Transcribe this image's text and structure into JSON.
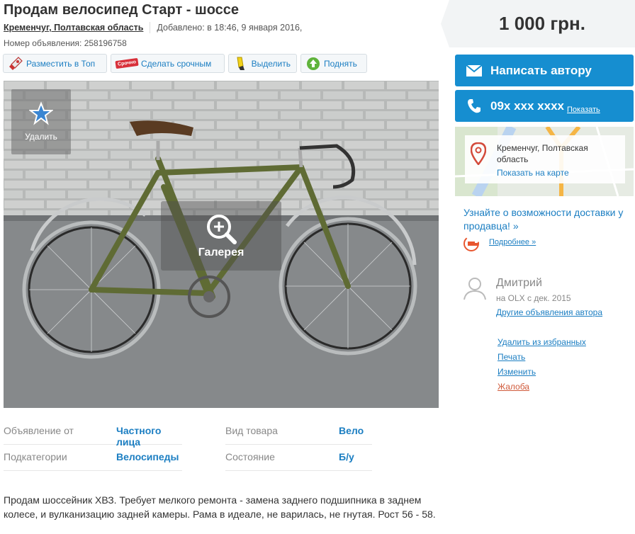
{
  "ad": {
    "title": "Продам велосипед Старт - шоссе",
    "location": "Кременчуг, Полтавская область",
    "added": "Добавлено: в 18:46, 9 января 2016,",
    "ad_number": "Номер объявления: 258196758"
  },
  "toolbar": [
    {
      "label": "Разместить в Топ",
      "icon": "rocket-icon"
    },
    {
      "label": "Сделать срочным",
      "icon": "urgent-tag-icon",
      "tag": "Срочно"
    },
    {
      "label": "Выделить",
      "icon": "highlighter-icon"
    },
    {
      "label": "Поднять",
      "icon": "arrow-up-icon"
    }
  ],
  "photo": {
    "favorite_label": "Удалить",
    "gallery_label": "Галерея"
  },
  "details": [
    {
      "key": "Объявление от",
      "value": "Частного лица"
    },
    {
      "key": "Вид товара",
      "value": "Вело"
    },
    {
      "key": "Подкатегории",
      "value": "Велосипеды"
    },
    {
      "key": "Состояние",
      "value": "Б/у"
    }
  ],
  "description": "Продам шоссейник ХВЗ. Требует мелкого ремонта - замена заднего подшипника в заднем колесе, и вулканизацию задней камеры. Рама в идеале, не варилась, не гнутая. Рост 56 - 58.",
  "sidebar": {
    "price": "1 000 грн.",
    "write_author": "Написать автору",
    "phone": "09x xxx xxxx",
    "show_phone": "Показать",
    "map_location": "Кременчуг, Полтавская область",
    "show_on_map": "Показать на карте",
    "delivery_text": "Узнайте о возможности доставки у продавца! »",
    "more_link": "Подробнее »",
    "user_name": "Дмитрий",
    "user_since": "на OLX с дек. 2015",
    "user_other_ads": "Другие объявления автора",
    "actions": [
      "Удалить из избранных",
      "Печать",
      "Изменить",
      "Жалоба"
    ]
  },
  "colors": {
    "accent": "#168ed0",
    "link": "#1b7ec2",
    "complaint": "#d05a3a"
  }
}
